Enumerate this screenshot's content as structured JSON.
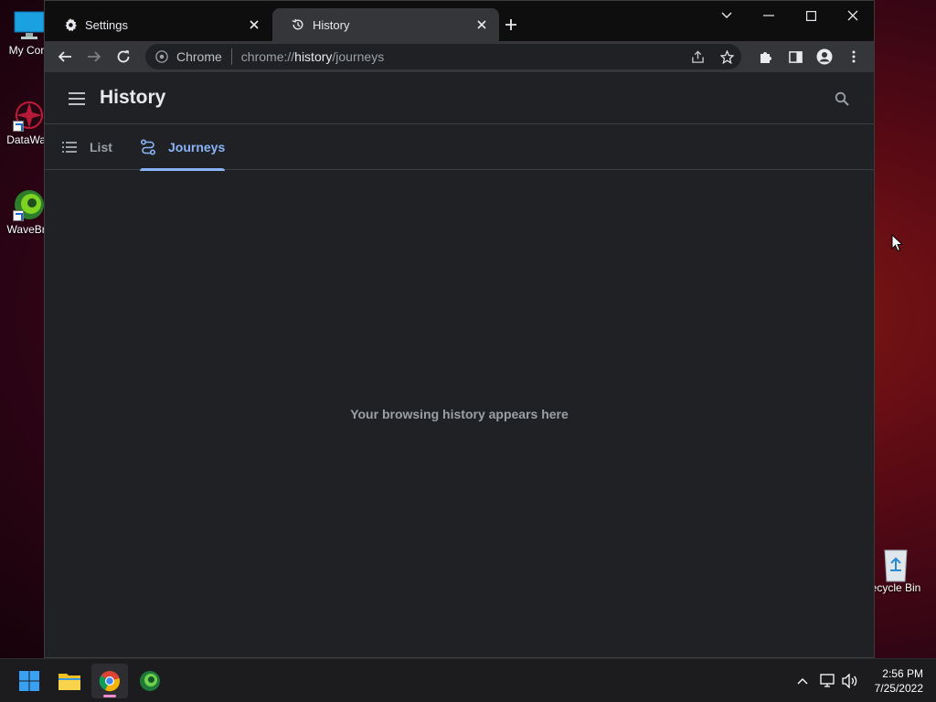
{
  "desktop": {
    "icons": [
      {
        "label": "My Com",
        "icon": "computer-icon"
      },
      {
        "label": "DataWag",
        "icon": "datawag-app-icon"
      },
      {
        "label": "WaveBro",
        "icon": "wavebrowser-icon"
      },
      {
        "label": "ecycle Bin",
        "icon": "recycle-bin-icon"
      }
    ]
  },
  "browser": {
    "tabs": [
      {
        "title": "Settings",
        "icon": "gear-icon",
        "active": false
      },
      {
        "title": "History",
        "icon": "history-icon",
        "active": true
      }
    ],
    "omnibox": {
      "scheme_label": "Chrome",
      "url_prefix": "chrome://",
      "url_host": "history",
      "url_path": "/journeys"
    }
  },
  "history_page": {
    "title": "History",
    "tabs": [
      {
        "label": "List",
        "icon": "list-icon",
        "selected": false
      },
      {
        "label": "Journeys",
        "icon": "journeys-icon",
        "selected": true
      }
    ],
    "empty_message": "Your browsing history appears here"
  },
  "taskbar": {
    "apps": [
      "start-icon",
      "file-explorer-icon",
      "chrome-icon",
      "edge-icon"
    ],
    "clock": {
      "time": "2:56 PM",
      "date": "7/25/2022"
    }
  },
  "colors": {
    "accent": "#8ab4f8",
    "page_bg": "#202124",
    "toolbar_bg": "#35363a"
  }
}
